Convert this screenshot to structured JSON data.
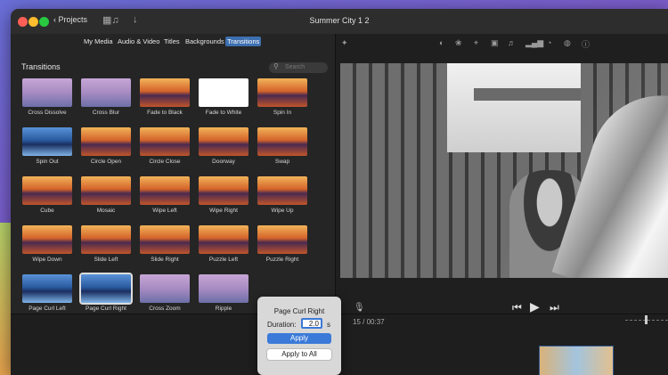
{
  "window": {
    "title": "Summer City 1 2"
  },
  "toolbar": {
    "projects_label": "Projects",
    "back_icon": "chevron-left-icon",
    "media_icon": "film-icon",
    "import_icon": "download-arrow-icon"
  },
  "browser": {
    "tabs": [
      {
        "label": "My Media",
        "active": false
      },
      {
        "label": "Audio & Video",
        "active": false
      },
      {
        "label": "Titles",
        "active": false
      },
      {
        "label": "Backgrounds",
        "active": false
      },
      {
        "label": "Transitions",
        "active": true
      }
    ],
    "panel_title": "Transitions",
    "search_placeholder": "Search",
    "transitions": [
      {
        "label": "Cross Dissolve",
        "style": "purple"
      },
      {
        "label": "Cross Blur",
        "style": "purple"
      },
      {
        "label": "Fade to Black",
        "style": "warm"
      },
      {
        "label": "Fade to White",
        "style": "white"
      },
      {
        "label": "Spin In",
        "style": "warm"
      },
      {
        "label": "Spin Out",
        "style": "blue"
      },
      {
        "label": "Circle Open",
        "style": "warm"
      },
      {
        "label": "Circle Close",
        "style": "warm"
      },
      {
        "label": "Doorway",
        "style": "warm"
      },
      {
        "label": "Swap",
        "style": "warm"
      },
      {
        "label": "Cube",
        "style": "warm"
      },
      {
        "label": "Mosaic",
        "style": "warm"
      },
      {
        "label": "Wipe Left",
        "style": "warm"
      },
      {
        "label": "Wipe Right",
        "style": "warm"
      },
      {
        "label": "Wipe Up",
        "style": "warm"
      },
      {
        "label": "Wipe Down",
        "style": "warm"
      },
      {
        "label": "Slide Left",
        "style": "warm"
      },
      {
        "label": "Slide Right",
        "style": "warm"
      },
      {
        "label": "Puzzle Left",
        "style": "warm"
      },
      {
        "label": "Puzzle Right",
        "style": "warm"
      },
      {
        "label": "Page Curl Left",
        "style": "blue"
      },
      {
        "label": "Page Curl Right",
        "style": "blue",
        "selected": true
      },
      {
        "label": "Cross Zoom",
        "style": "purple"
      },
      {
        "label": "Ripple",
        "style": "purple"
      }
    ]
  },
  "viewer": {
    "tools": [
      "magic-wand-icon",
      "color-balance-icon",
      "color-correction-icon",
      "crop-icon",
      "stabilization-icon",
      "volume-icon",
      "noise-reduction-icon",
      "speed-icon",
      "filter-icon",
      "info-icon"
    ],
    "transport": [
      "skip-back-icon",
      "play-icon",
      "skip-forward-icon"
    ]
  },
  "timeline": {
    "timecode_partial": "15",
    "timecode_total": "00:37",
    "separator": "/"
  },
  "popover": {
    "title": "Page Curl Right",
    "duration_label": "Duration:",
    "duration_value": "2.0",
    "duration_unit": "s",
    "apply_label": "Apply",
    "apply_all_label": "Apply to All"
  },
  "colors": {
    "accent": "#3b7ad8",
    "window_bg": "#262626",
    "tab_active": "#3d6fb0"
  }
}
